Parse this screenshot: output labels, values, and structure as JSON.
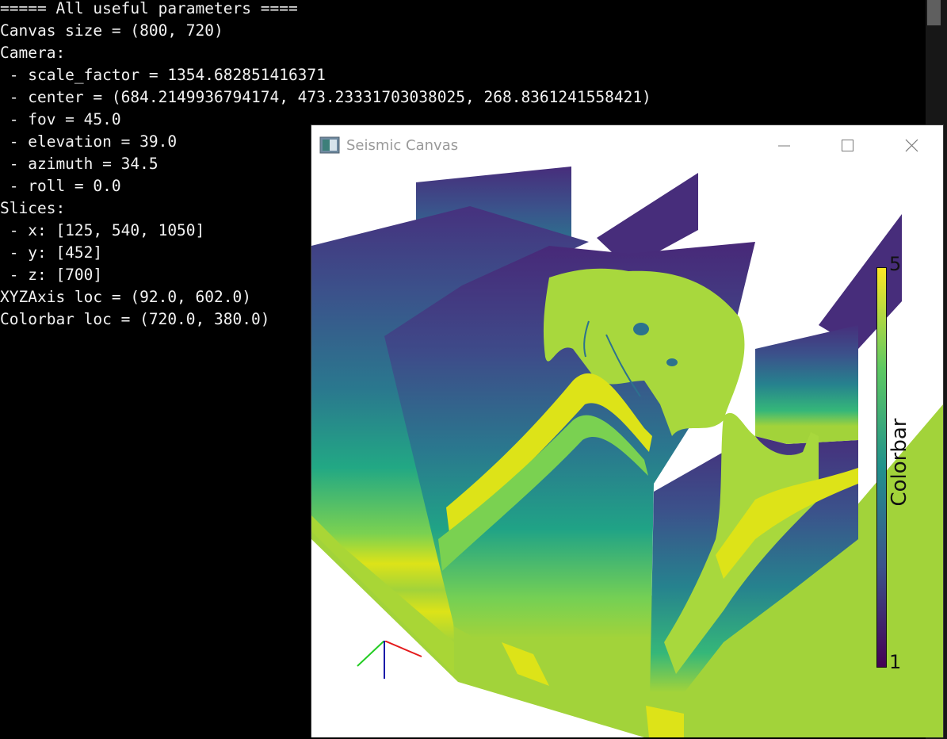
{
  "console": {
    "lines": [
      "===== All useful parameters ====",
      "Canvas size = (800, 720)",
      "Camera:",
      " - scale_factor = 1354.682851416371",
      " - center = (684.2149936794174, 473.23331703038025, 268.8361241558421)",
      " - fov = 45.0",
      " - elevation = 39.0",
      " - azimuth = 34.5",
      " - roll = 0.0",
      "Slices:",
      " - x: [125, 540, 1050]",
      " - y: [452]",
      " - z: [700]",
      "XYZAxis loc = (92.0, 602.0)",
      "Colorbar loc = (720.0, 380.0)"
    ]
  },
  "window": {
    "title": "Seismic Canvas",
    "icons": [
      "app-icon",
      "minimize-icon",
      "maximize-icon",
      "close-icon"
    ]
  },
  "colorbar": {
    "label": "Colorbar",
    "max_label": "5",
    "min_label": "1",
    "colormap": [
      "#440154",
      "#3b528b",
      "#21918c",
      "#5ec962",
      "#fde725"
    ]
  },
  "axis": {
    "x_color": "#e41a1c",
    "y_color": "#22cc22",
    "z_color": "#1a1aa8"
  },
  "colors": {
    "console_bg": "#000000",
    "console_text": "#f2f2f2",
    "floor": "#a2d33a",
    "top": "#472d7b",
    "yellow": "#dde318"
  }
}
